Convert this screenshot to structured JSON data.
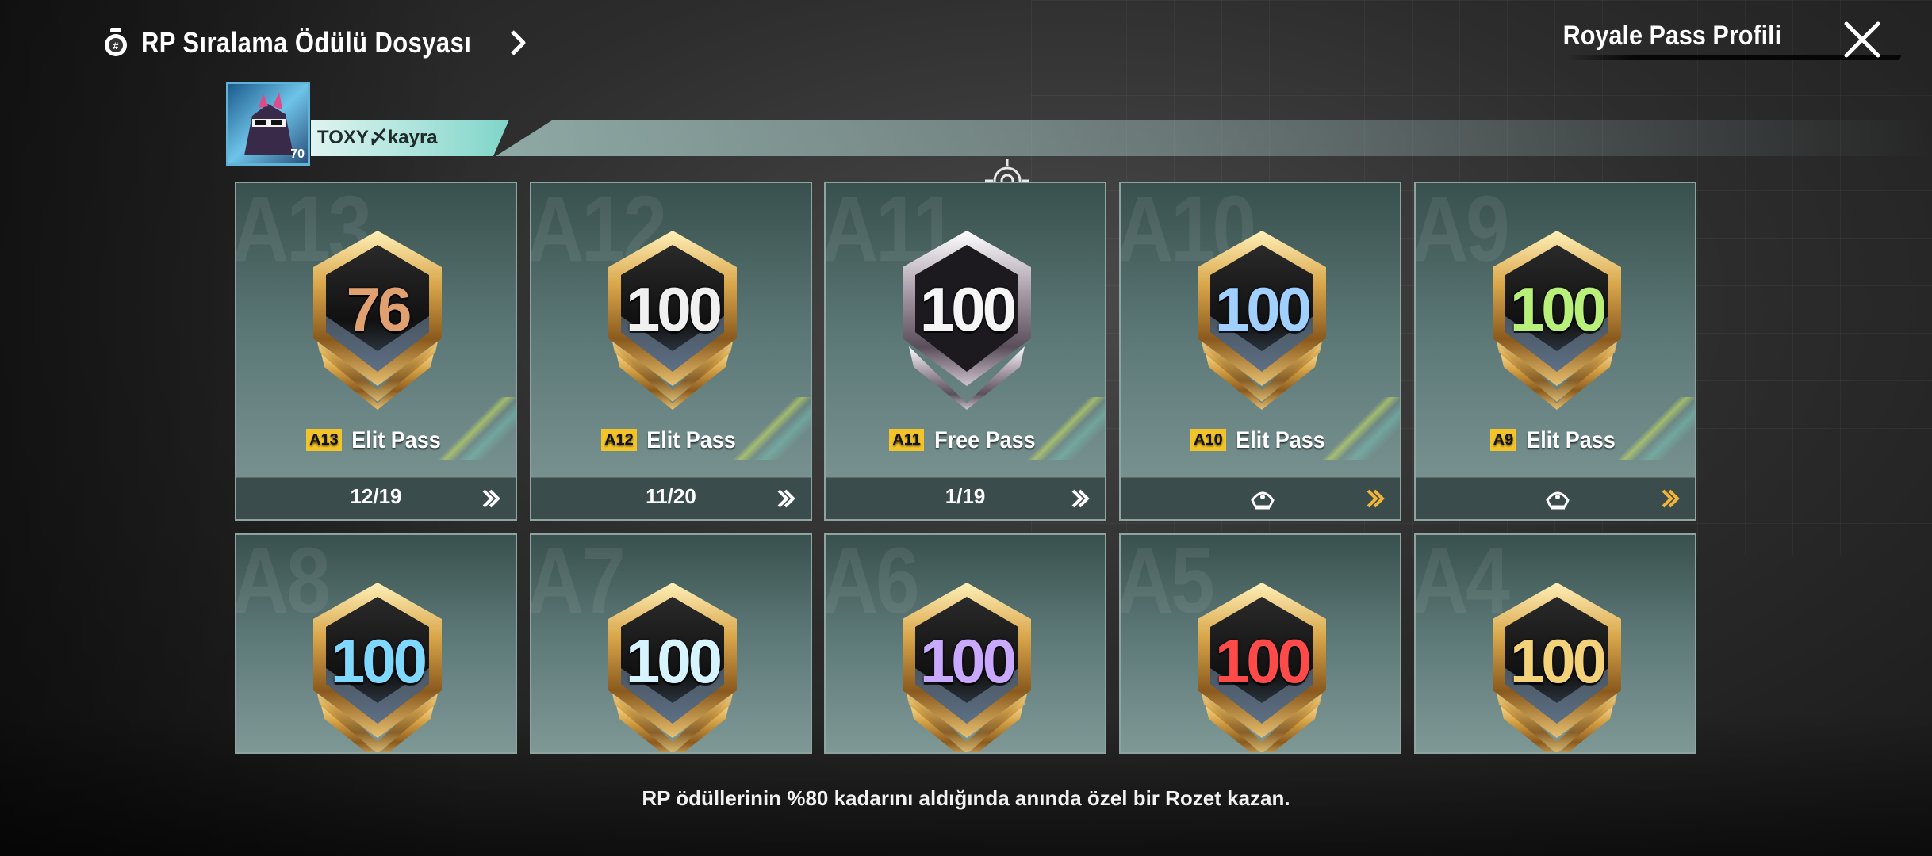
{
  "header": {
    "title": "RP Sıralama Ödülü Dosyası",
    "profile_link": "Royale Pass Profili"
  },
  "player": {
    "name": "TOXY〆kayra",
    "avatar_level": "70"
  },
  "cards": [
    {
      "code": "A13",
      "badge": "76",
      "pass_tag": "A13",
      "pass_name": "Elit Pass",
      "progress": "12/19",
      "badge_style": "gold",
      "number_color": "#e0a070"
    },
    {
      "code": "A12",
      "badge": "100",
      "pass_tag": "A12",
      "pass_name": "Elit Pass",
      "progress": "11/20",
      "badge_style": "gold",
      "number_color": "#f0f0f0"
    },
    {
      "code": "A11",
      "badge": "100",
      "pass_tag": "A11",
      "pass_name": "Free Pass",
      "progress": "1/19",
      "badge_style": "silver",
      "number_color": "#f5f5f5"
    },
    {
      "code": "A10",
      "badge": "100",
      "pass_tag": "A10",
      "pass_name": "Elit Pass",
      "progress": "",
      "badge_style": "gold",
      "number_color": "#9fd0ff"
    },
    {
      "code": "A9",
      "badge": "100",
      "pass_tag": "A9",
      "pass_name": "Elit Pass",
      "progress": "",
      "badge_style": "gold",
      "number_color": "#b9f07a"
    },
    {
      "code": "A8",
      "badge": "100",
      "badge_style": "gold",
      "number_color": "#7fd8ff"
    },
    {
      "code": "A7",
      "badge": "100",
      "badge_style": "gold",
      "number_color": "#d6f4ff"
    },
    {
      "code": "A6",
      "badge": "100",
      "badge_style": "gold",
      "number_color": "#c9a8ff"
    },
    {
      "code": "A5",
      "badge": "100",
      "badge_style": "gold",
      "number_color": "#ff4a4a"
    },
    {
      "code": "A4",
      "badge": "100",
      "badge_style": "gold",
      "number_color": "#f3d27a"
    }
  ],
  "footer_note": "RP ödüllerinin %80 kadarını aldığında anında özel bir Rozet kazan.",
  "colors": {
    "pass_tag": "#f2c429",
    "chevron_white": "#ffffff",
    "chevron_gold": "#f0b43a"
  }
}
